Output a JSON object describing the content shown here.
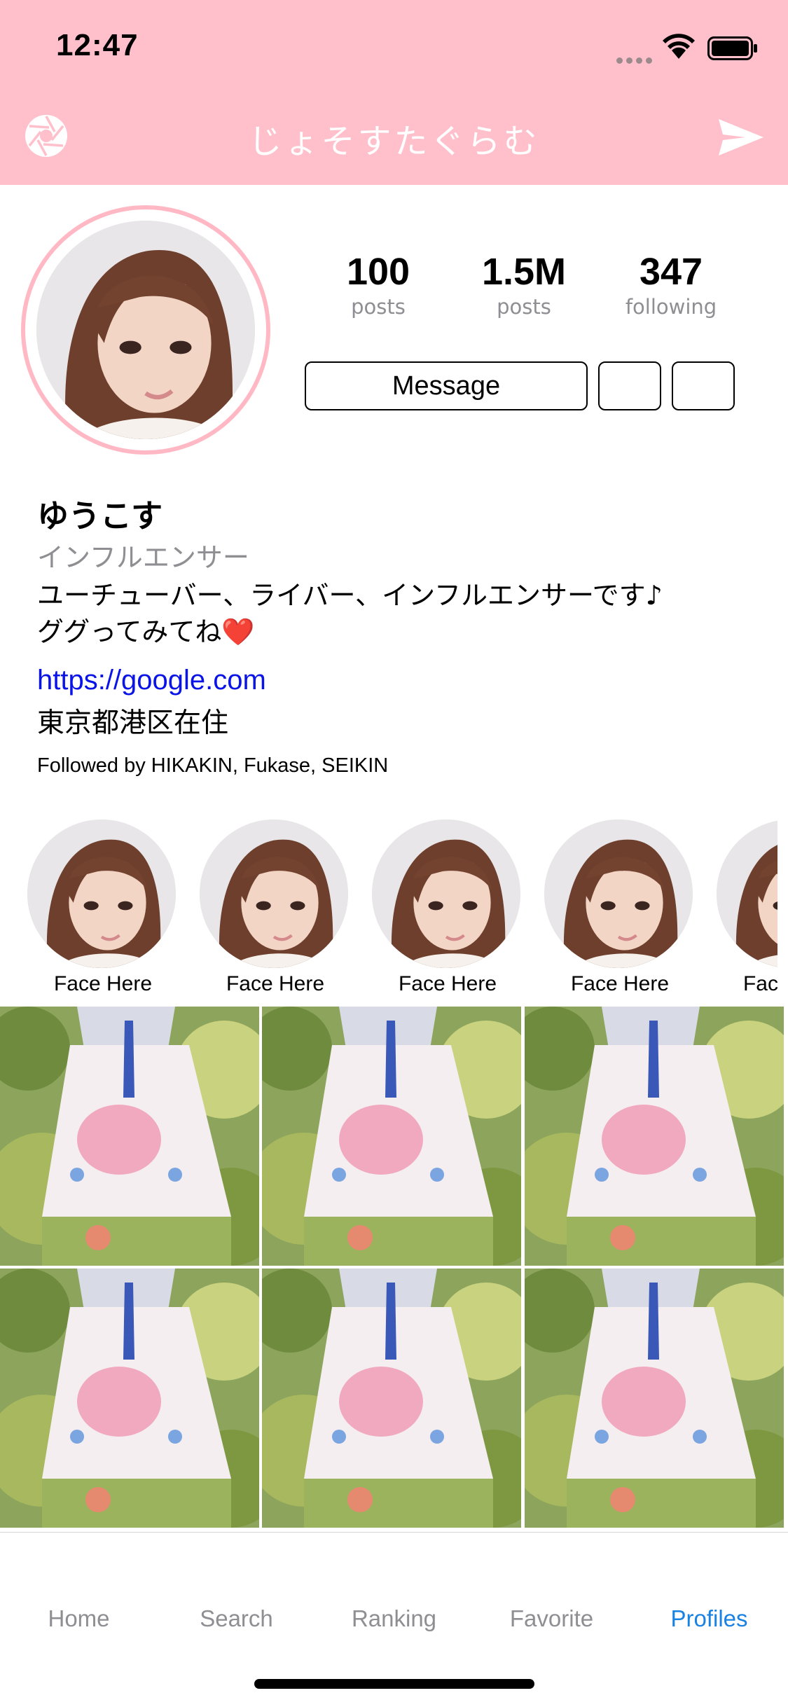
{
  "status_bar": {
    "time": "12:47"
  },
  "nav": {
    "title": "じょそすたぐらむ"
  },
  "profile": {
    "stats": [
      {
        "value": "100",
        "label": "posts"
      },
      {
        "value": "1.5M",
        "label": "posts"
      },
      {
        "value": "347",
        "label": "following"
      }
    ],
    "message_label": "Message",
    "name": "ゆうこす",
    "category": "インフルエンサー",
    "bio_line1": "ユーチューバー、ライバー、インフルエンサーです♪",
    "bio_line2": "ググってみてね❤️",
    "link": "https://google.com",
    "location": "東京都港区在住",
    "followed_by": "Followed by HIKAKIN, Fukase, SEIKIN"
  },
  "stories": [
    {
      "label": "Face Here"
    },
    {
      "label": "Face Here"
    },
    {
      "label": "Face Here"
    },
    {
      "label": "Face Here"
    },
    {
      "label": "Face Here"
    }
  ],
  "tabs": [
    {
      "label": "Home"
    },
    {
      "label": "Search"
    },
    {
      "label": "Ranking"
    },
    {
      "label": "Favorite"
    },
    {
      "label": "Profiles",
      "active": true
    }
  ],
  "colors": {
    "header_pink": "#ffc0cb",
    "avatar_ring": "#ffb8c4",
    "link_blue": "#0b14e6",
    "tab_active": "#1a82e2",
    "tab_inactive": "#8e8e93"
  }
}
